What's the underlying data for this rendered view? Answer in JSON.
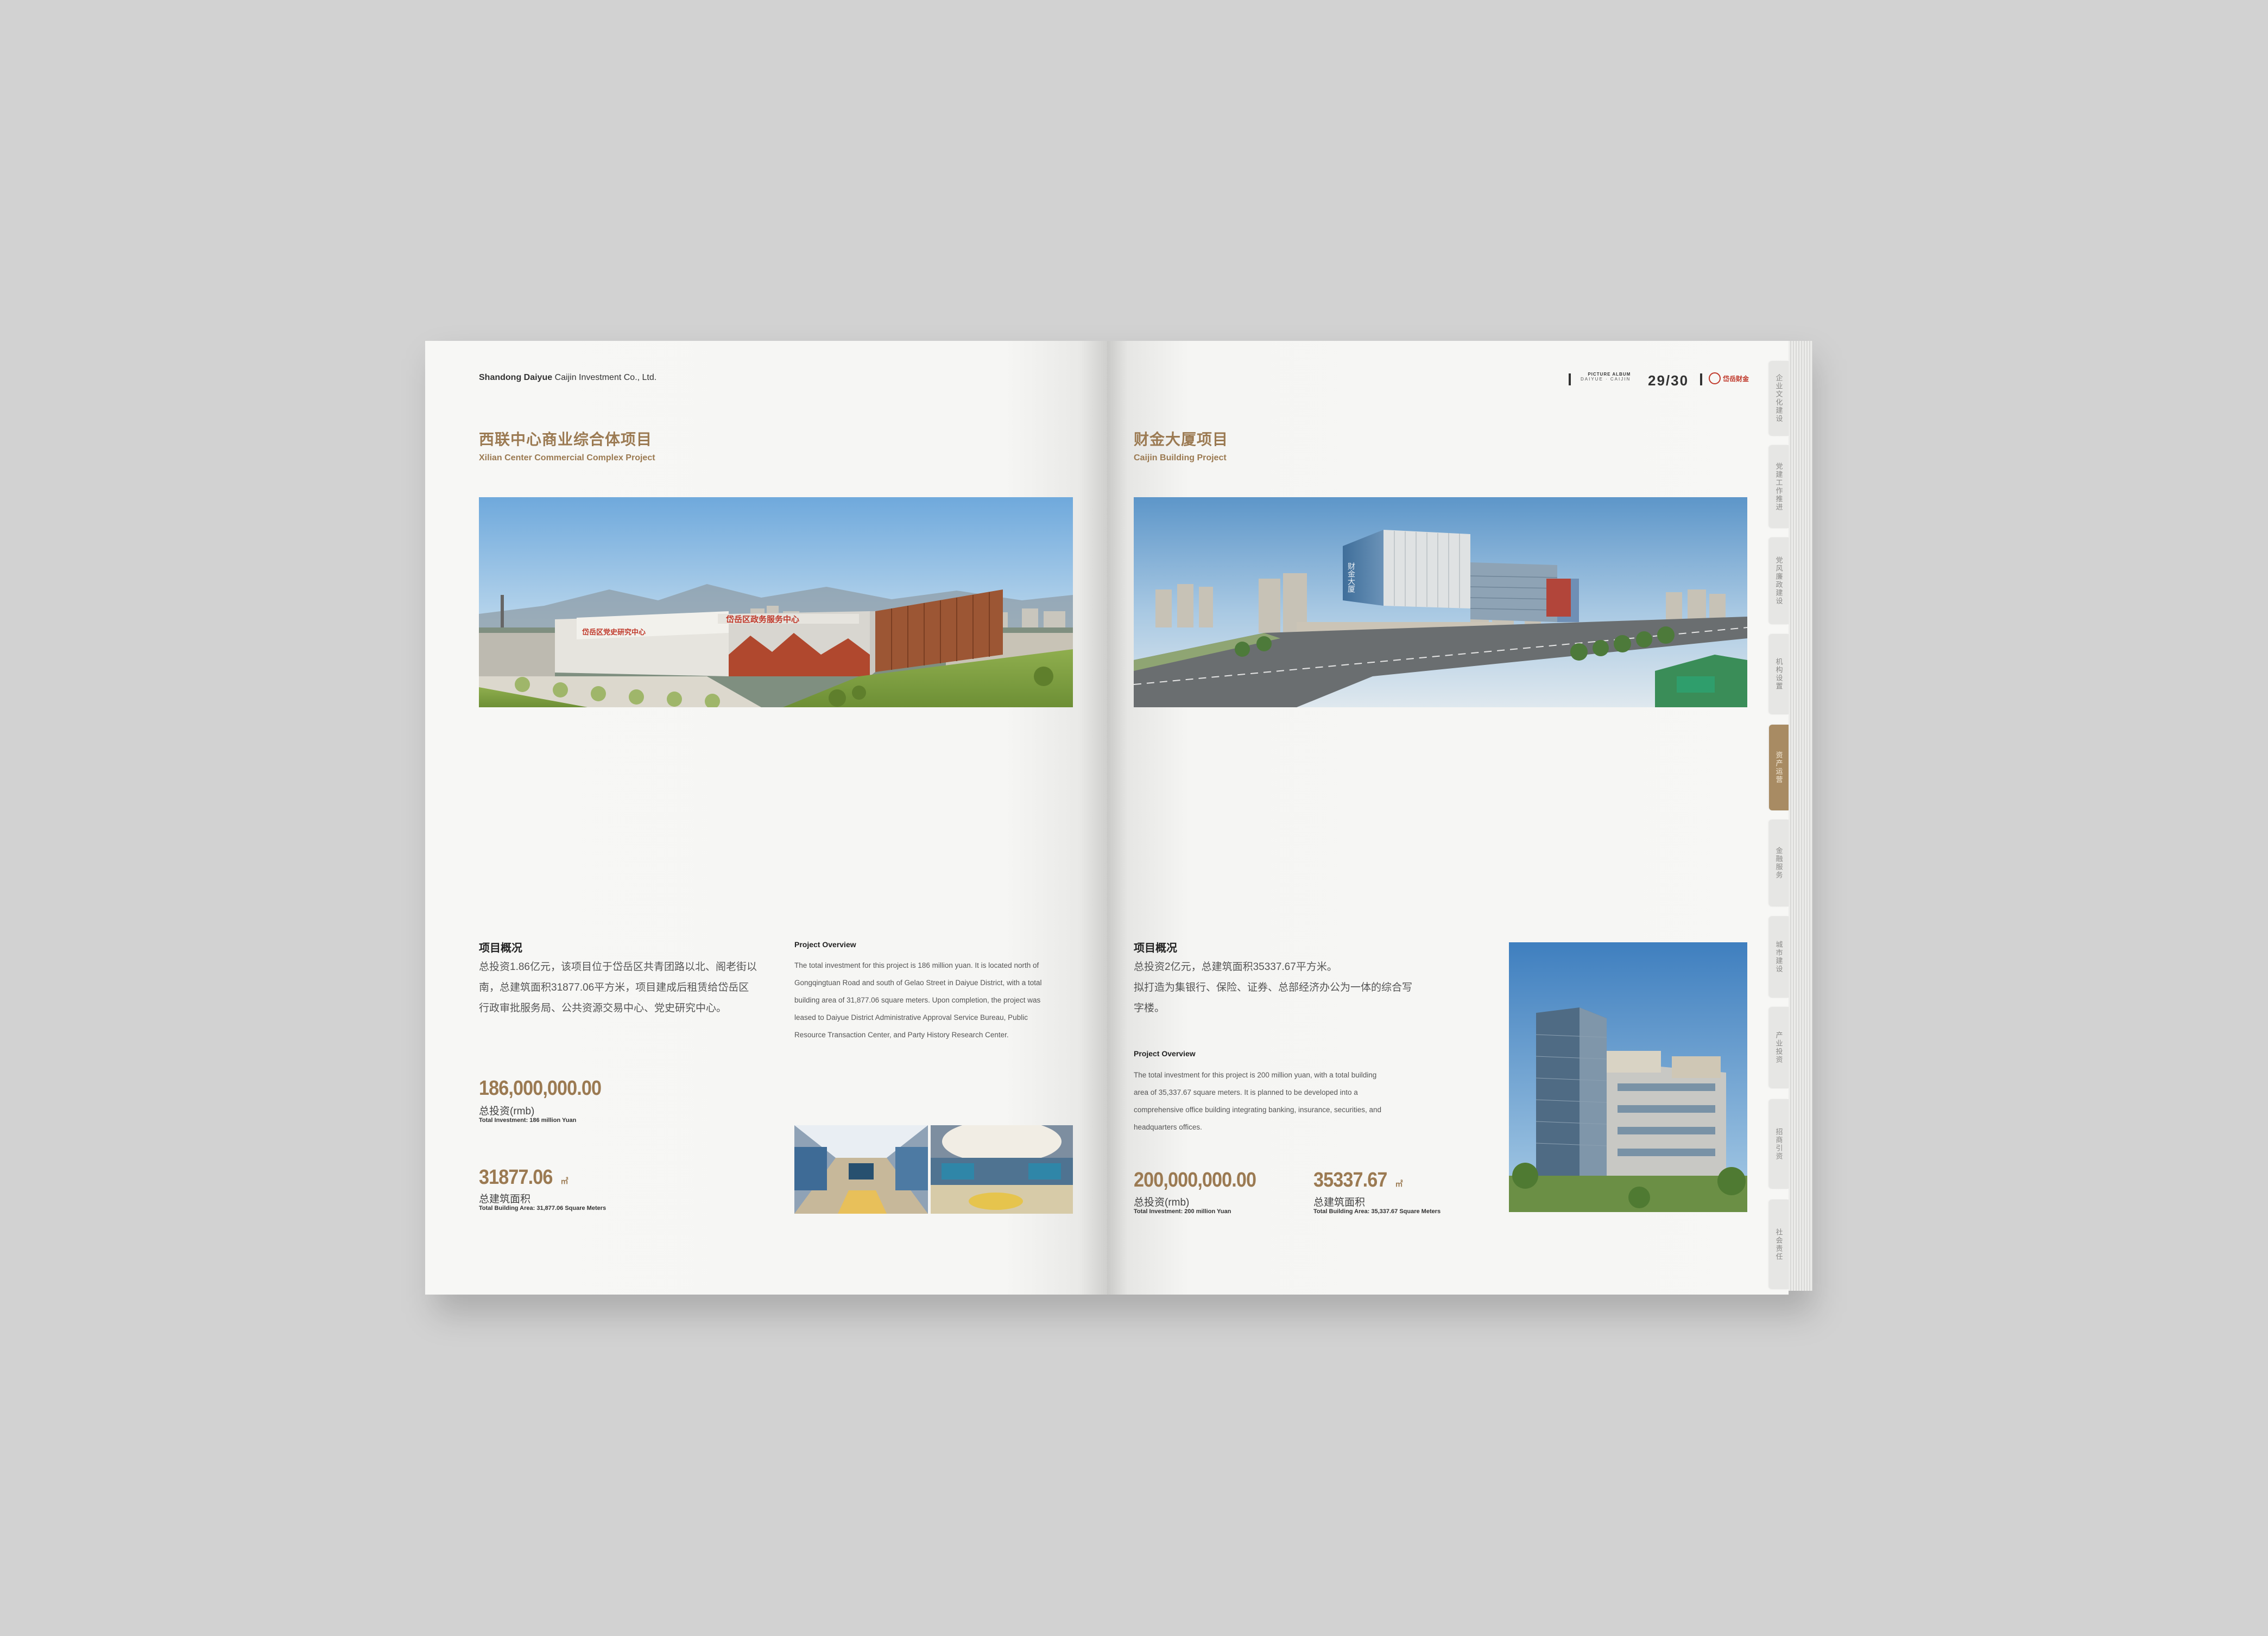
{
  "left_page": {
    "header": {
      "company_bold": "Shandong Daiyue",
      "company_rest": "Caijin Investment Co., Ltd."
    },
    "title_cn": "西联中心商业综合体项目",
    "title_en": "Xilian Center Commercial Complex Project",
    "overview_cn_heading": "项目概况",
    "overview_cn_lines": [
      "总投资1.86亿元，该项目位于岱岳区共青团路以北、阁老街以",
      "南，总建筑面积31877.06平方米，项目建成后租赁给岱岳区",
      "行政审批服务局、公共资源交易中心、党史研究中心。"
    ],
    "overview_en_heading": "Project Overview",
    "overview_en_lines": [
      "The total investment for this project is 186 million yuan. It is located north of",
      "Gongqingtuan Road and south of Gelao Street in Daiyue District, with a total",
      "building area of 31,877.06 square meters. Upon completion, the project was",
      "leased to Daiyue District Administrative Approval Service Bureau, Public",
      "Resource Transaction Center, and Party History Research Center."
    ],
    "investment_value": "186,000,000.00",
    "investment_label": "总投资(rmb)",
    "investment_sub": "Total Investment: 186 million Yuan",
    "area_value": "31877.06",
    "area_unit": "㎡",
    "area_label": "总建筑面积",
    "area_sub": "Total Building Area: 31,877.06 Square Meters"
  },
  "right_page": {
    "header": {
      "album_label": "PICTURE ALBUM",
      "album_sub": "DAIYUE · CAIJIN",
      "page_number": "29/30",
      "logo_text": "岱岳财金"
    },
    "title_cn": "财金大厦项目",
    "title_en": "Caijin Building Project",
    "overview_cn_heading": "项目概况",
    "overview_cn_lines": [
      "总投资2亿元，总建筑面积35337.67平方米。",
      "拟打造为集银行、保险、证券、总部经济办公为一体的综合写",
      "字楼。"
    ],
    "overview_en_heading": "Project Overview",
    "overview_en_lines": [
      "The total investment for this project is 200 million yuan, with a total building",
      "area of 35,337.67 square meters. It is planned to be developed into a",
      "comprehensive office building integrating banking, insurance, securities, and",
      "headquarters offices."
    ],
    "investment_value": "200,000,000.00",
    "investment_label": "总投资(rmb)",
    "investment_sub": "Total Investment: 200 million Yuan",
    "area_value": "35337.67",
    "area_unit": "㎡",
    "area_label": "总建筑面积",
    "area_sub": "Total Building Area: 35,337.67 Square Meters",
    "building_sign": "财金大厦"
  },
  "side_tabs": [
    {
      "label": "企业文化建设",
      "active": false
    },
    {
      "label": "党建工作推进",
      "active": false
    },
    {
      "label": "党风廉政建设",
      "active": false
    },
    {
      "label": "机构设置",
      "active": false
    },
    {
      "label": "资产运营",
      "active": true
    },
    {
      "label": "金融服务",
      "active": false
    },
    {
      "label": "城市建设",
      "active": false
    },
    {
      "label": "产业投资",
      "active": false
    },
    {
      "label": "招商引资",
      "active": false
    },
    {
      "label": "社会责任",
      "active": false
    }
  ],
  "photo_signs": {
    "left_facade": "岱岳区政务服务中心",
    "left_wing": "岱岳区党史研究中心"
  },
  "colors": {
    "accent": "#9b7a52",
    "tab_active": "#a88b63",
    "page": "#f7f7f5",
    "background": "#d2d2d2"
  }
}
